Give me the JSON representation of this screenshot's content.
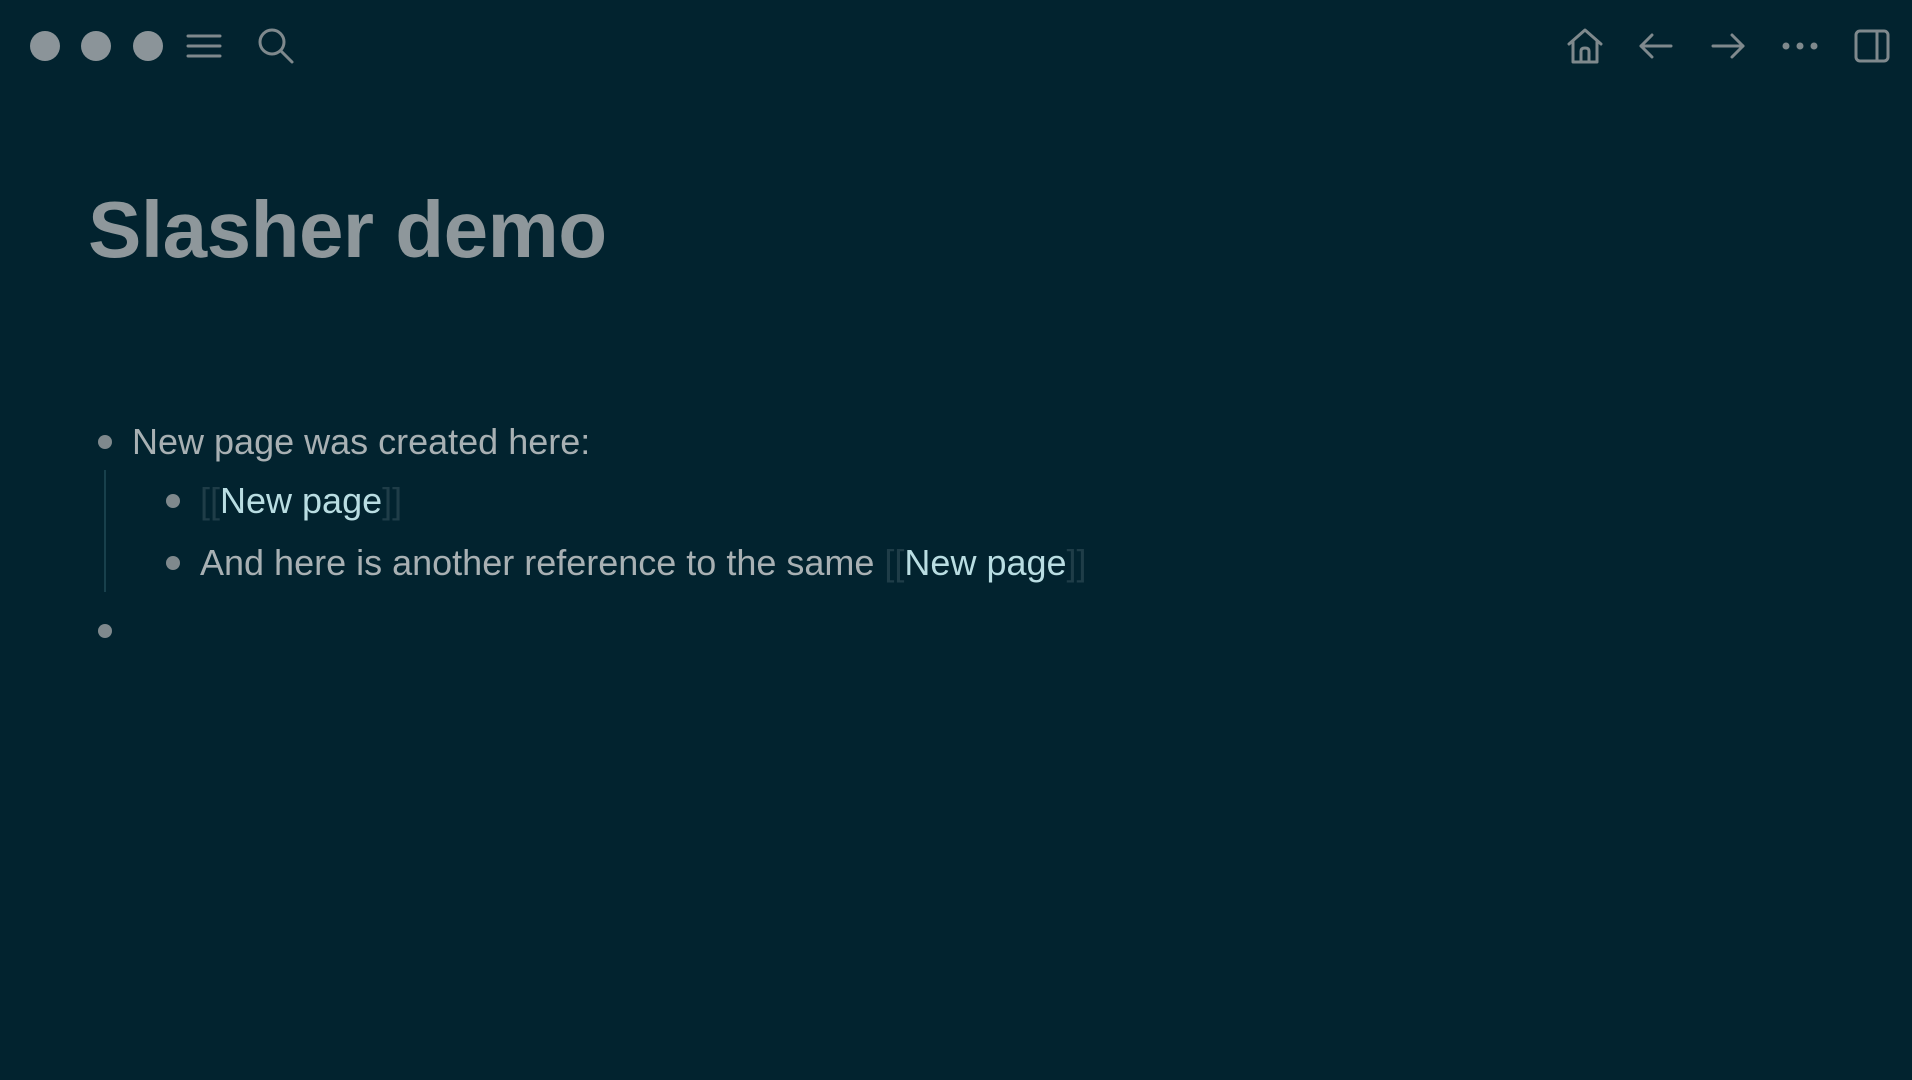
{
  "colors": {
    "background": "#02232f",
    "title": "#8e979b",
    "text": "#a8b0b3",
    "page_ref": "#b9dde2",
    "bracket": "#1f3d48",
    "bullet": "#7f898d",
    "traffic_light": "#8b9499"
  },
  "toolbar": {
    "left_icons": [
      "menu-icon",
      "search-icon"
    ],
    "right_icons": [
      "home-icon",
      "arrow-left-icon",
      "arrow-right-icon",
      "more-icon",
      "sidebar-toggle-icon"
    ]
  },
  "page": {
    "title": "Slasher demo"
  },
  "blocks": [
    {
      "text": "New page was created here:",
      "children": [
        {
          "open_bracket": "[[",
          "ref": "New page",
          "close_bracket": "]]"
        },
        {
          "text": "And here is another reference to the same ",
          "open_bracket": "[[",
          "ref": "New page",
          "close_bracket": "]]"
        }
      ]
    },
    {
      "text": ""
    }
  ]
}
